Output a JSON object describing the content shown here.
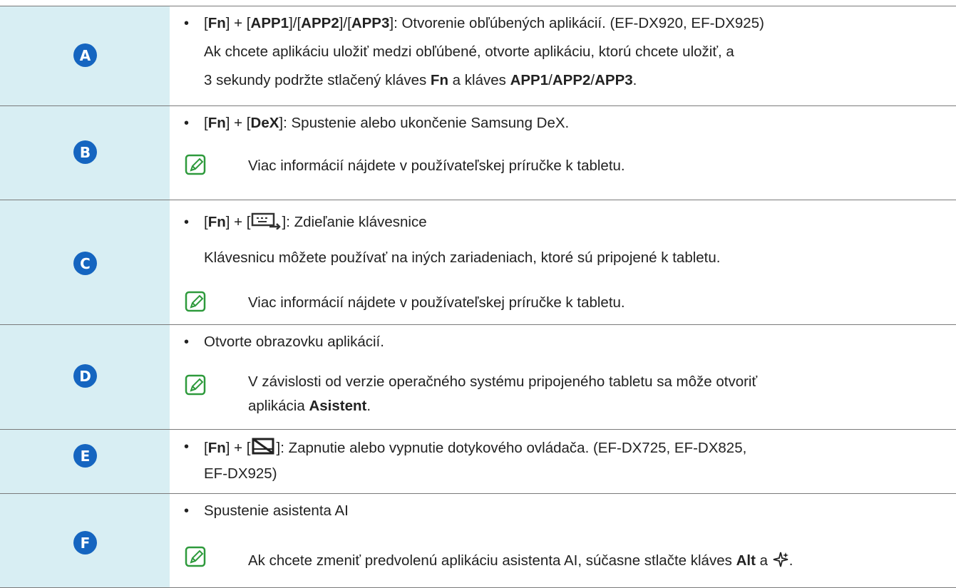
{
  "rows": [
    {
      "letter": "A",
      "line1": {
        "pre1": "[",
        "fn": "Fn",
        "mid1": "] + [",
        "app1": "APP1",
        "mid2": "]/[",
        "app2": "APP2",
        "mid3": "]/[",
        "app3": "APP3",
        "post": "]: Otvorenie obľúbených aplikácií. (EF-DX920, EF-DX925)"
      },
      "line2": "Ak chcete aplikáciu uložiť medzi obľúbené, otvorte aplikáciu, ktorú chcete uložiť, a",
      "line3": {
        "pre": "3 sekundy podržte stlačený kláves ",
        "fn": "Fn",
        "mid": " a kláves ",
        "app1": "APP1",
        "s1": "/",
        "app2": "APP2",
        "s2": "/",
        "app3": "APP3",
        "end": "."
      }
    },
    {
      "letter": "B",
      "line1": {
        "pre": "[",
        "fn": "Fn",
        "mid": "] + [",
        "dex": "DeX",
        "post": "]: Spustenie alebo ukončenie Samsung DeX."
      },
      "note": "Viac informácií nájdete v používateľskej príručke k tabletu."
    },
    {
      "letter": "C",
      "line1": {
        "pre": "[",
        "fn": "Fn",
        "mid": "] + [",
        "post": "]: Zdieľanie klávesnice"
      },
      "line2": "Klávesnicu môžete používať na iných zariadeniach, ktoré sú pripojené k tabletu.",
      "note": "Viac informácií nájdete v používateľskej príručke k tabletu."
    },
    {
      "letter": "D",
      "line1": "Otvorte obrazovku aplikácií.",
      "note1": "V závislosti od verzie operačného systému pripojeného tabletu sa môže otvoriť",
      "note2": {
        "pre": "aplikácia ",
        "b": "Asistent",
        "end": "."
      }
    },
    {
      "letter": "E",
      "line1": {
        "pre": "[",
        "fn": "Fn",
        "mid": "] + [",
        "post": "]: Zapnutie alebo vypnutie dotykového ovládača. (EF-DX725, EF-DX825,"
      },
      "line2": "EF-DX925)"
    },
    {
      "letter": "F",
      "line1": "Spustenie asistenta AI",
      "note": {
        "pre": "Ak chcete zmeniť predvolenú aplikáciu asistenta AI, súčasne stlačte kláves ",
        "b": "Alt",
        "mid": " a ",
        "end": "."
      }
    }
  ],
  "bullet_char": "•",
  "colors": {
    "key_cell_bg": "#d8eef3",
    "badge": "#1565c0",
    "note_icon": "#2e9a3c"
  },
  "icons": {
    "note": "note-pencil-icon",
    "share_key": "keyboard-share-icon",
    "touchpad_key": "touchpad-off-icon",
    "ai_key": "sparkle-ai-icon"
  }
}
